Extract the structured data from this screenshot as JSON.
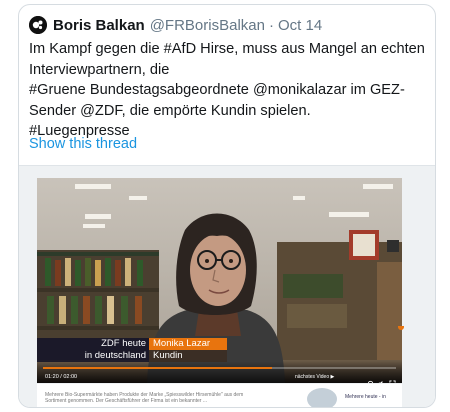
{
  "tweet": {
    "author_name": "Boris Balkan",
    "handle": "@FRBorisBalkan",
    "separator": "·",
    "date": "Oct 14",
    "text": "Im Kampf gegen die #AfD Hirse, muss aus  Mangel an echten Interviewpartnern, die\n#Gruene Bundestagsabgeordnete @monikalazar im GEZ-Sender @ZDF, die empörte Kundin spielen.\n#Luegenpresse",
    "show_thread": "Show this thread"
  },
  "video": {
    "channel_line1": "ZDF heute",
    "channel_line2": "in deutschland",
    "person_name": "Monika Lazar",
    "person_role": "Kundin",
    "time": "01:20 / 02:00",
    "next_label": "nächstes Video ▶",
    "progress": 0.65
  },
  "below_video": {
    "caption": "Mehrere Bio-Supermärkte haben Produkte der Marke „Spiesswilder Hirsemühle\" aus dem Sortiment genommen. Der Geschäftsführer der Firma ist ein bekannter ...",
    "side_text": "Mehrere heute - in"
  },
  "colors": {
    "link": "#1b95e0",
    "zdf_orange": "#e8740e",
    "muted": "#657786"
  }
}
